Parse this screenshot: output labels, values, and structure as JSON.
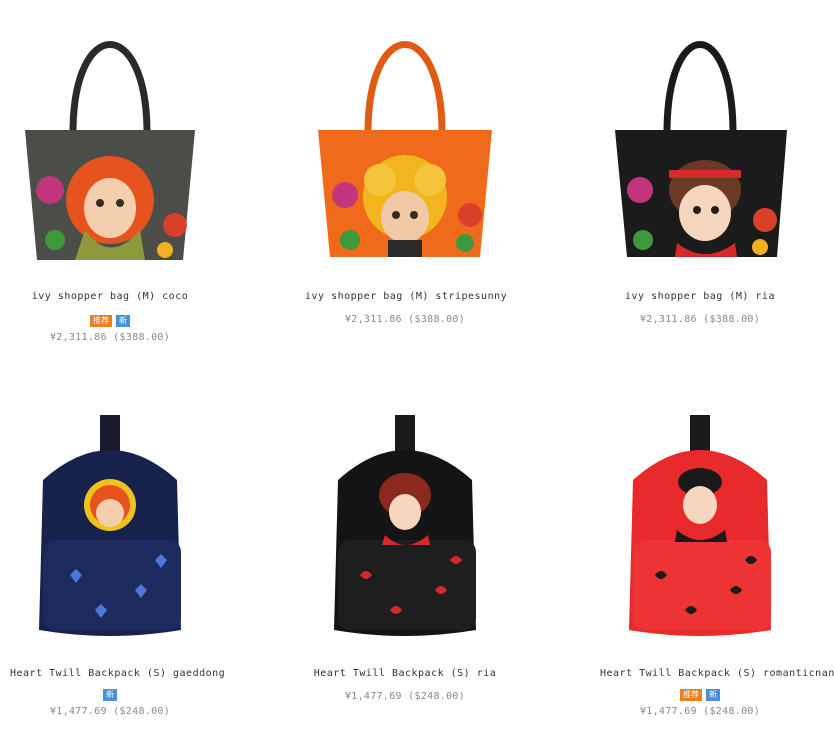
{
  "colors": {
    "badge_recommend": "#e8811a",
    "badge_new": "#4a90d9",
    "price_text": "#888888"
  },
  "products": [
    {
      "name": "ivy shopper bag (M) coco",
      "price": "¥2,311.86 ($388.00)",
      "badges": [
        "推荐",
        "新"
      ],
      "image": "tote-bag-gray-redhead-girl"
    },
    {
      "name": "ivy shopper bag (M) stripesunny",
      "price": "¥2,311.86 ($388.00)",
      "badges": [],
      "image": "tote-bag-orange-curly-girl"
    },
    {
      "name": "ivy shopper bag (M) ria",
      "price": "¥2,311.86 ($388.00)",
      "badges": [],
      "image": "tote-bag-black-headband-girl"
    },
    {
      "name": "Heart Twill Backpack (S) gaeddong",
      "price": "¥1,477.69 ($248.00)",
      "badges": [
        "新"
      ],
      "image": "backpack-navy-hearts-girl"
    },
    {
      "name": "Heart Twill Backpack (S) ria",
      "price": "¥1,477.69 ($248.00)",
      "badges": [],
      "image": "backpack-black-hearts-girl"
    },
    {
      "name": "Heart Twill Backpack (S) romanticnani",
      "price": "¥1,477.69 ($248.00)",
      "badges": [
        "推荐",
        "新"
      ],
      "image": "backpack-red-hearts-girl"
    }
  ]
}
